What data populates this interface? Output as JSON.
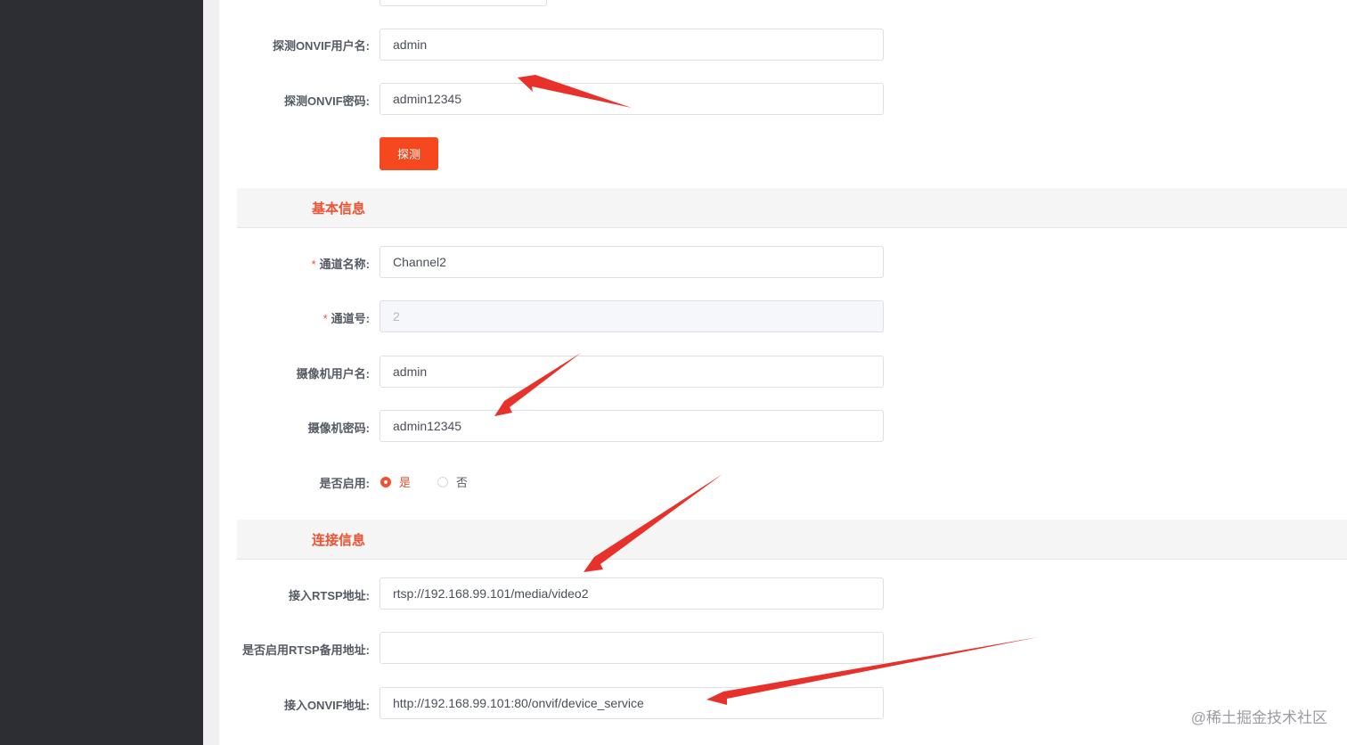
{
  "detect": {
    "username_label": "探测ONVIF用户名:",
    "username_value": "admin",
    "password_label": "探测ONVIF密码:",
    "password_value": "admin12345",
    "button_label": "探测"
  },
  "basic_info": {
    "section_title": "基本信息",
    "channel_name_label": "通道名称:",
    "channel_name_value": "Channel2",
    "channel_no_label": "通道号:",
    "channel_no_value": "2",
    "camera_user_label": "摄像机用户名:",
    "camera_user_value": "admin",
    "camera_password_label": "摄像机密码:",
    "camera_password_value": "admin12345",
    "enabled_label": "是否启用:",
    "enabled_yes": "是",
    "enabled_no": "否",
    "required_mark": "*"
  },
  "connection_info": {
    "section_title": "连接信息",
    "rtsp_label": "接入RTSP地址:",
    "rtsp_value": "rtsp://192.168.99.101/media/video2",
    "rtsp_backup_label": "是否启用RTSP备用地址:",
    "rtsp_backup_value": "",
    "onvif_label": "接入ONVIF地址:",
    "onvif_value": "http://192.168.99.101:80/onvif/device_service"
  },
  "watermark": "@稀土掘金技术社区",
  "colors": {
    "accent": "#f25030",
    "button": "#f5481f",
    "sidebar": "#2c2e33",
    "annotation_arrow": "#e8312b"
  }
}
